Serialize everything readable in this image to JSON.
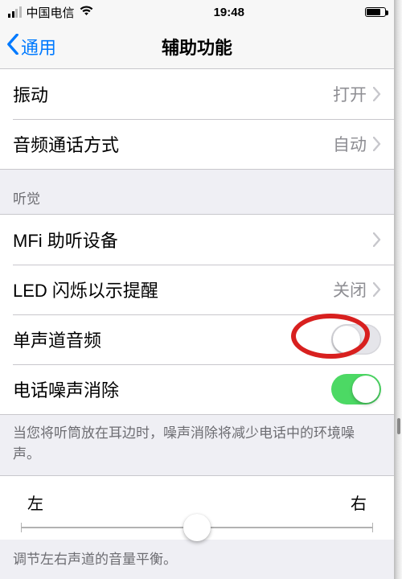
{
  "statusbar": {
    "carrier": "中国电信",
    "time": "19:48"
  },
  "navbar": {
    "back_label": "通用",
    "title": "辅助功能"
  },
  "section1": {
    "vibration": {
      "label": "振动",
      "value": "打开"
    },
    "call_audio": {
      "label": "音频通话方式",
      "value": "自动"
    }
  },
  "hearing_header": "听觉",
  "section2": {
    "mfi": {
      "label": "MFi 助听设备"
    },
    "led": {
      "label": "LED 闪烁以示提醒",
      "value": "关闭"
    },
    "mono": {
      "label": "单声道音频",
      "on": false
    },
    "noise": {
      "label": "电话噪声消除",
      "on": true
    }
  },
  "noise_footer": "当您将听筒放在耳边时，噪声消除将减少电话中的环境噪声。",
  "balance": {
    "left_label": "左",
    "right_label": "右",
    "footer": "调节左右声道的音量平衡。"
  }
}
